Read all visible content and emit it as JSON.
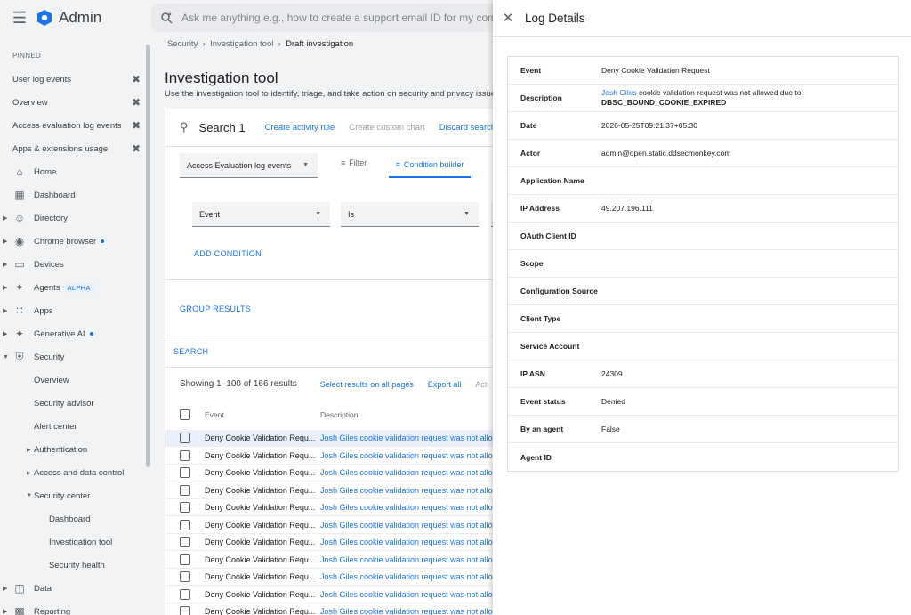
{
  "topbar": {
    "app_name": "Admin",
    "search_placeholder": "Ask me anything e.g., how to create a support email ID for my company"
  },
  "sidebar": {
    "pinned_title": "PINNED",
    "pinned": [
      {
        "label": "User log events"
      },
      {
        "label": "Overview"
      },
      {
        "label": "Access evaluation log events"
      },
      {
        "label": "Apps & extensions usage"
      }
    ],
    "nav": [
      {
        "label": "Home",
        "icon": "home-icon",
        "caret": false
      },
      {
        "label": "Dashboard",
        "icon": "dashboard-icon",
        "caret": false
      },
      {
        "label": "Directory",
        "icon": "person-icon",
        "caret": true
      },
      {
        "label": "Chrome browser",
        "icon": "chrome-icon",
        "caret": true,
        "dot": true
      },
      {
        "label": "Devices",
        "icon": "devices-icon",
        "caret": true
      },
      {
        "label": "Agents",
        "icon": "agents-icon",
        "caret": true,
        "badge": "ALPHA"
      },
      {
        "label": "Apps",
        "icon": "apps-grid-icon",
        "caret": true
      },
      {
        "label": "Generative AI",
        "icon": "sparkle-icon",
        "caret": true,
        "dot": true
      },
      {
        "label": "Security",
        "icon": "shield-icon",
        "caret": true,
        "expanded": true
      }
    ],
    "security_children": {
      "overview": "Overview",
      "advisor": "Security advisor",
      "alert_center": "Alert center",
      "authentication": "Authentication",
      "access_data": "Access and data control",
      "security_center": "Security center",
      "sc_dashboard": "Dashboard",
      "sc_investigation": "Investigation tool",
      "sc_health": "Security health"
    },
    "after": [
      {
        "label": "Data",
        "icon": "folder-icon"
      },
      {
        "label": "Reporting",
        "icon": "bar-chart-icon"
      }
    ]
  },
  "main": {
    "breadcrumb": [
      "Security",
      "Investigation tool",
      "Draft investigation"
    ],
    "title": "Investigation tool",
    "subtitle": "Use the investigation tool to identify, triage, and take action on security and privacy issues",
    "search_title": "Search 1",
    "create_activity_rule": "Create activity rule",
    "create_custom_chart": "Create custom chart",
    "discard_search": "Discard search",
    "data_source": "Access Evaluation log events",
    "filter_tab": "Filter",
    "condition_builder_tab": "Condition builder",
    "condition_field": "Event",
    "condition_operator": "Is",
    "add_condition": "ADD CONDITION",
    "group_results": "GROUP RESULTS",
    "search_button": "SEARCH",
    "results_count": "Showing 1–100 of 166 results",
    "select_all_pages": "Select results on all pages",
    "export_all": "Export all",
    "actions_label": "Act",
    "col_event": "Event",
    "col_description": "Description",
    "rows": [
      {
        "event": "Deny Cookie Validation Requ...",
        "description": "Josh Giles cookie validation request was not allo"
      },
      {
        "event": "Deny Cookie Validation Requ...",
        "description": "Josh Giles cookie validation request was not allo"
      },
      {
        "event": "Deny Cookie Validation Requ...",
        "description": "Josh Giles cookie validation request was not allo"
      },
      {
        "event": "Deny Cookie Validation Requ...",
        "description": "Josh Giles cookie validation request was not allo"
      },
      {
        "event": "Deny Cookie Validation Requ...",
        "description": "Josh Giles cookie validation request was not allo"
      },
      {
        "event": "Deny Cookie Validation Requ...",
        "description": "Josh Giles cookie validation request was not allo"
      },
      {
        "event": "Deny Cookie Validation Requ...",
        "description": "Josh Giles cookie validation request was not allo"
      },
      {
        "event": "Deny Cookie Validation Requ...",
        "description": "Josh Giles cookie validation request was not allo"
      },
      {
        "event": "Deny Cookie Validation Requ...",
        "description": "Josh Giles cookie validation request was not allo"
      },
      {
        "event": "Deny Cookie Validation Requ...",
        "description": "Josh Giles cookie validation request was not allo"
      },
      {
        "event": "Deny Cookie Validation Requ...",
        "description": "Josh Giles cookie validation request was not allo"
      }
    ]
  },
  "panel": {
    "title": "Log Details",
    "rows": [
      {
        "key": "Event",
        "value": "Deny Cookie Validation Request"
      },
      {
        "key": "Description",
        "link": "Josh Giles",
        "value": " cookie validation request was not allowed due to",
        "bold": "DBSC_BOUND_COOKIE_EXPIRED"
      },
      {
        "key": "Date",
        "value": "2026-05-25T09:21:37+05:30"
      },
      {
        "key": "Actor",
        "value": "admin@open.static.ddsecmonkey.com"
      },
      {
        "key": "Application Name",
        "value": ""
      },
      {
        "key": "IP Address",
        "value": "49.207.196.111"
      },
      {
        "key": "OAuth Client ID",
        "value": ""
      },
      {
        "key": "Scope",
        "value": ""
      },
      {
        "key": "Configuration Source",
        "value": ""
      },
      {
        "key": "Client Type",
        "value": ""
      },
      {
        "key": "Service Account",
        "value": ""
      },
      {
        "key": "IP ASN",
        "value": "24309"
      },
      {
        "key": "Event status",
        "value": "Denied"
      },
      {
        "key": "By an agent",
        "value": "False"
      },
      {
        "key": "Agent ID",
        "value": ""
      }
    ]
  },
  "colors": {
    "accent": "#1a73e8",
    "background": "#f1f3f4"
  }
}
